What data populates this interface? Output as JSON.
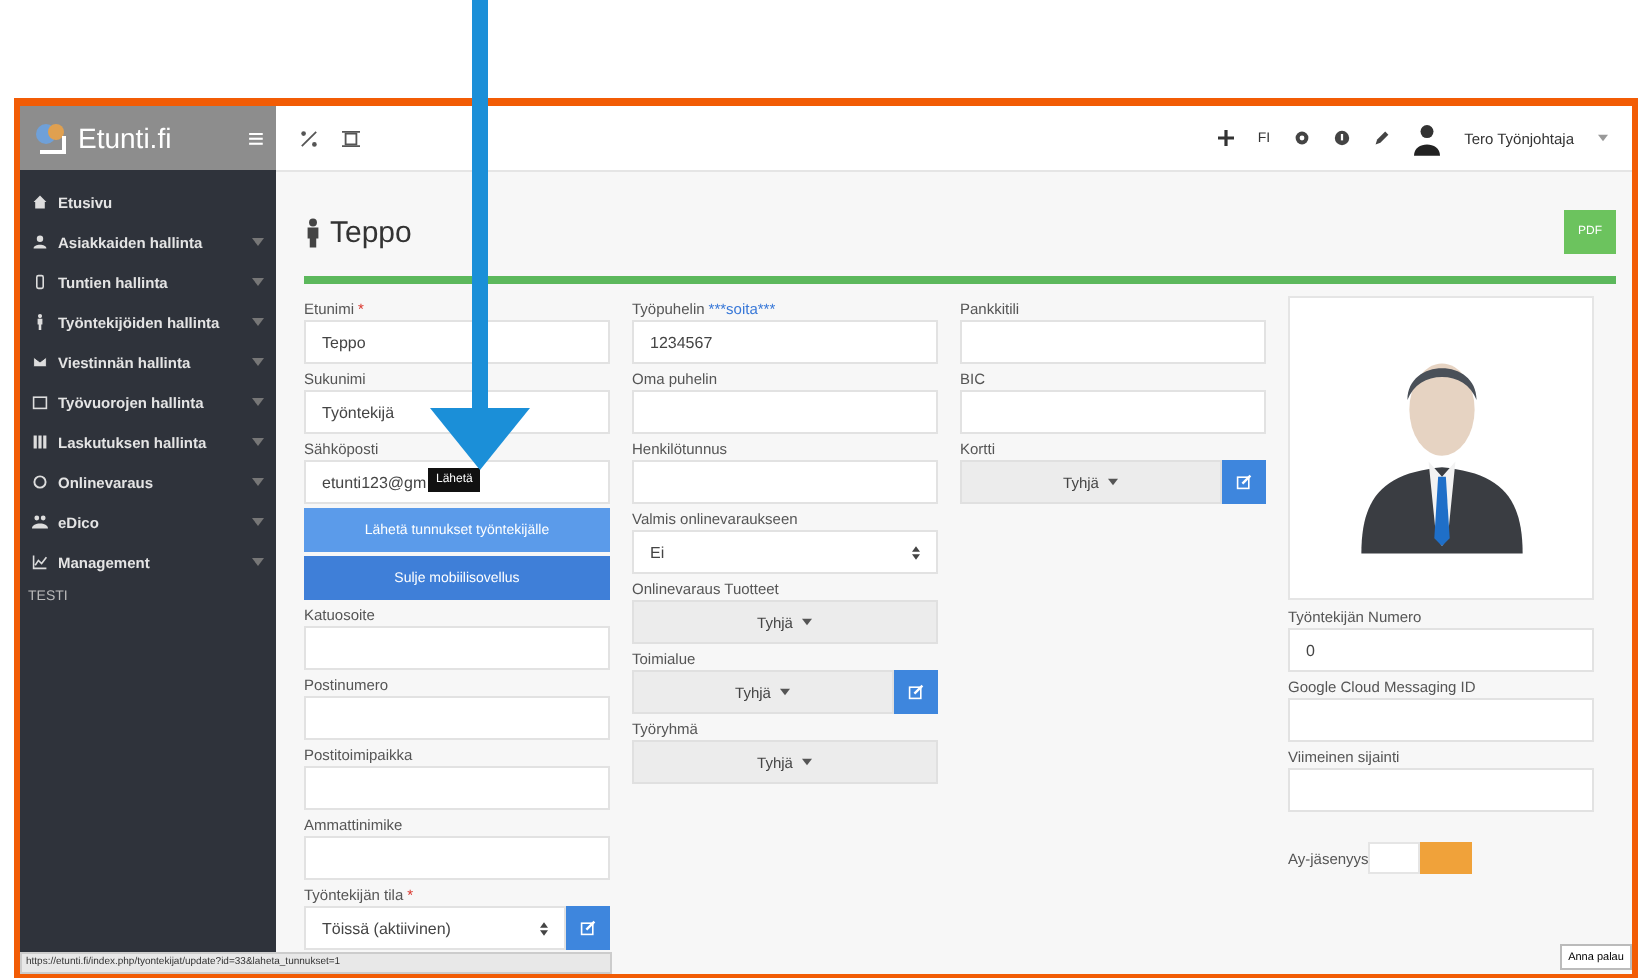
{
  "brand": {
    "logo_text": "Etunti.fi",
    "menu_icon": "≡"
  },
  "sidebar": {
    "items": [
      {
        "label": "Etusivu",
        "expandable": false
      },
      {
        "label": "Asiakkaiden hallinta",
        "expandable": true
      },
      {
        "label": "Tuntien hallinta",
        "expandable": true
      },
      {
        "label": "Työntekijöiden hallinta",
        "expandable": true
      },
      {
        "label": "Viestinnän hallinta",
        "expandable": true
      },
      {
        "label": "Työvuorojen hallinta",
        "expandable": true
      },
      {
        "label": "Laskutuksen hallinta",
        "expandable": true
      },
      {
        "label": "Onlinevaraus",
        "expandable": true
      },
      {
        "label": "eDico",
        "expandable": true
      },
      {
        "label": "Management",
        "expandable": true
      }
    ],
    "footer": "TESTI"
  },
  "topbar": {
    "language": "FI",
    "user": "Tero Työnjohtaja"
  },
  "page": {
    "title": "Teppo",
    "pdf_button": "PDF"
  },
  "columns": [
    [
      {
        "kind": "text",
        "label": "Etunimi",
        "required_mark": "*",
        "value": "Teppo"
      },
      {
        "kind": "text",
        "label": "Sukunimi",
        "value": "Työntekijä"
      },
      {
        "kind": "text",
        "label": "Sähköposti",
        "value": "etunti123@gm",
        "tooltip": "Lähetä"
      },
      {
        "kind": "button",
        "label": "Lähetä tunnukset työntekijälle",
        "color": "#5b9bea"
      },
      {
        "kind": "button",
        "label": "Sulje mobiilisovellus",
        "color": "#3f7fd8"
      },
      {
        "kind": "text",
        "label": "Katuosoite"
      },
      {
        "kind": "text",
        "label": "Postinumero"
      },
      {
        "kind": "text",
        "label": "Postitoimipaikka"
      },
      {
        "kind": "text",
        "label": "Ammattinimike"
      },
      {
        "kind": "select",
        "label": "Työntekijän tila",
        "required_mark": "*",
        "value": "Töissä (aktiivinen)",
        "editable": true
      }
    ],
    [
      {
        "kind": "text",
        "label": "Työpuhelin",
        "link": "***soita***",
        "value": "1234567"
      },
      {
        "kind": "text",
        "label": "Oma puhelin"
      },
      {
        "kind": "text",
        "label": "Henkilötunnus"
      },
      {
        "kind": "select",
        "label": "Valmis onlinevaraukseen",
        "value": "Ei",
        "editable": false
      },
      {
        "kind": "dropdown",
        "label": "Onlinevaraus Tuotteet",
        "value": "Tyhjä",
        "editable": false
      },
      {
        "kind": "dropdown",
        "label": "Toimialue",
        "value": "Tyhjä",
        "editable": true
      },
      {
        "kind": "dropdown",
        "label": "Työryhmä",
        "value": "Tyhjä",
        "editable": false
      }
    ],
    [
      {
        "kind": "text",
        "label": "Pankkitili"
      },
      {
        "kind": "text",
        "label": "BIC"
      },
      {
        "kind": "dropdown",
        "label": "Kortti",
        "value": "Tyhjä",
        "editable": true
      }
    ],
    [
      {
        "kind": "avatar"
      },
      {
        "kind": "text",
        "label": "Työntekijän Numero",
        "value": "0"
      },
      {
        "kind": "text",
        "label": "Google Cloud Messaging ID"
      },
      {
        "kind": "text",
        "label": "Viimeinen sijainti"
      },
      {
        "kind": "toggle",
        "label": "Ay-jäsenyys",
        "on": false
      }
    ]
  ],
  "status_bar": {
    "url": "https://etunti.fi/index.php/tyontekijat/update?id=33&laheta_tunnukset=1"
  },
  "corner_button": "Anna palau"
}
